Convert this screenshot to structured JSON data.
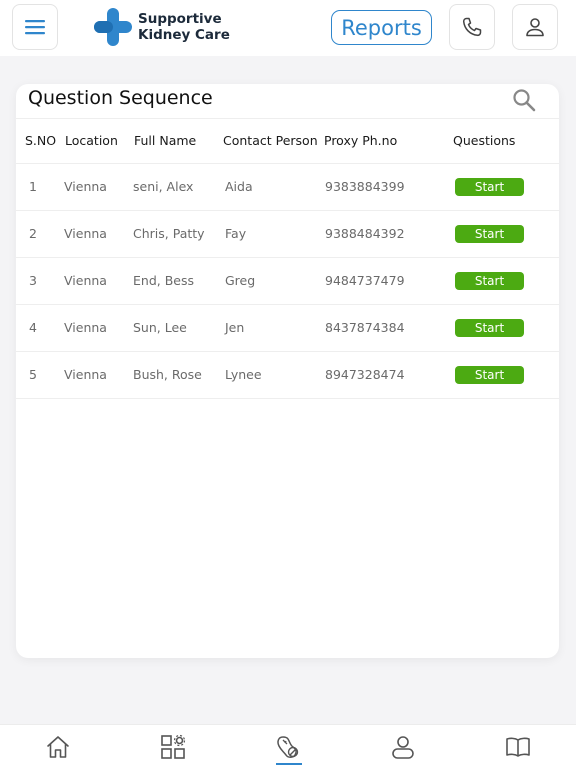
{
  "header": {
    "brand_line1": "Supportive",
    "brand_line2": "Kidney Care",
    "reports_label": "Reports",
    "icons": [
      "menu-icon",
      "phone-icon",
      "user-icon"
    ]
  },
  "card": {
    "title": "Question Sequence",
    "columns": [
      "S.NO",
      "Location",
      "Full Name",
      "Contact Person",
      "Proxy Ph.no",
      "Questions"
    ],
    "rows": [
      {
        "sno": "1",
        "location": "Vienna",
        "name": "seni, Alex",
        "contact": "Aida",
        "phone": "9383884399",
        "action": "Start"
      },
      {
        "sno": "2",
        "location": "Vienna",
        "name": "Chris, Patty",
        "contact": "Fay",
        "phone": "9388484392",
        "action": "Start"
      },
      {
        "sno": "3",
        "location": "Vienna",
        "name": "End, Bess",
        "contact": "Greg",
        "phone": "9484737479",
        "action": "Start"
      },
      {
        "sno": "4",
        "location": "Vienna",
        "name": "Sun, Lee",
        "contact": "Jen",
        "phone": "8437874384",
        "action": "Start"
      },
      {
        "sno": "5",
        "location": "Vienna",
        "name": "Bush, Rose",
        "contact": "Lynee",
        "phone": "8947328474",
        "action": "Start"
      }
    ]
  },
  "colors": {
    "accent": "#2f86cc",
    "start_button": "#4caa12",
    "background": "#f4f4f6"
  },
  "bottom_nav": {
    "items": [
      "home-icon",
      "dashboard-grid-icon",
      "kidney-icon",
      "profile-icon",
      "book-icon"
    ],
    "active": "kidney-icon"
  }
}
